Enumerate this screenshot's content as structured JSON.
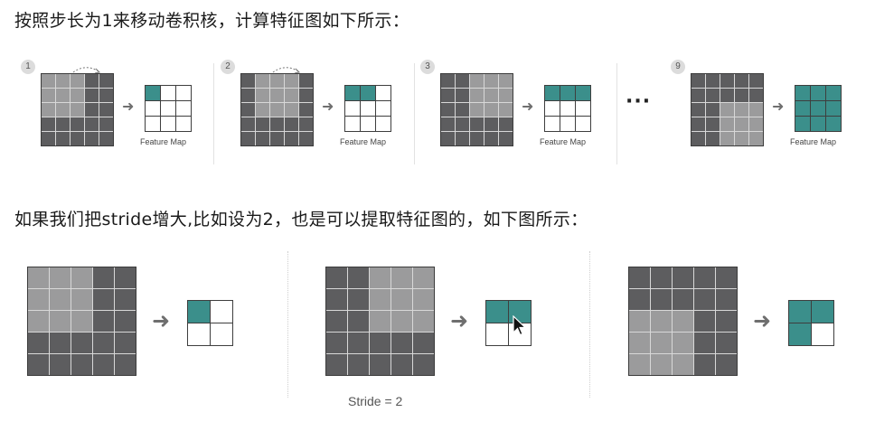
{
  "captions": {
    "top": "按照步长为1来移动卷积核，计算特征图如下所示：",
    "bottom": "如果我们把stride增大,比如设为2，也是可以提取特征图的，如下图所示："
  },
  "feature_map_label": "Feature Map",
  "ellipsis": "···",
  "stride_label": "Stride = 2",
  "arrow_icon": "➜",
  "colors": {
    "input_dark": "#5d5d5f",
    "input_light": "#9b9b9c",
    "feature_on": "#3b8f8b"
  },
  "top_row": [
    {
      "step": "1",
      "window": [
        0,
        0
      ],
      "filled": [
        0
      ]
    },
    {
      "step": "2",
      "window": [
        0,
        1
      ],
      "filled": [
        0,
        1
      ]
    },
    {
      "step": "3",
      "window": [
        0,
        2
      ],
      "filled": [
        0,
        1,
        2
      ]
    },
    {
      "step": "9",
      "window": [
        2,
        2
      ],
      "filled": [
        0,
        1,
        2,
        3,
        4,
        5,
        6,
        7,
        8
      ]
    }
  ],
  "bottom_row": [
    {
      "window": [
        0,
        0
      ],
      "filled": [
        0
      ]
    },
    {
      "window": [
        0,
        2
      ],
      "filled": [
        0,
        1
      ]
    },
    {
      "window": [
        2,
        0
      ],
      "filled": [
        0,
        1,
        2
      ]
    }
  ]
}
